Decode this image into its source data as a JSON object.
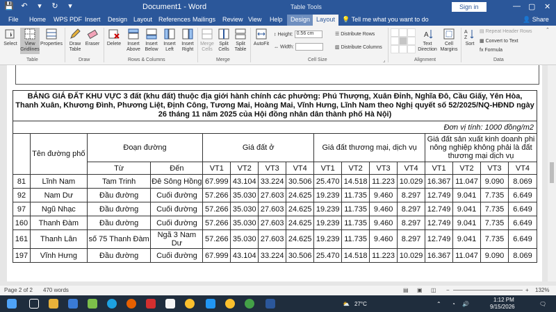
{
  "window": {
    "title": "Document1 - Word",
    "context_tools": "Table Tools",
    "sign_in": "Sign in",
    "minimize_glyph": "—",
    "restore_glyph": "▢",
    "close_glyph": "✕"
  },
  "quick_access": {
    "save": "💾",
    "undo": "↶",
    "undo_arrow": "▾",
    "redo": "↻",
    "customize": "▾"
  },
  "tabs": [
    "File",
    "Home",
    "WPS PDF",
    "Insert",
    "Design",
    "Layout",
    "References",
    "Mailings",
    "Review",
    "View",
    "Help",
    "Design",
    "Layout"
  ],
  "tell_me": "Tell me what you want to do",
  "share": "Share",
  "ribbon": {
    "select": "Select",
    "view_gridlines": "View Gridlines",
    "properties": "Properties",
    "draw_table": "Draw Table",
    "eraser": "Eraser",
    "delete": "Delete",
    "insert_above": "Insert Above",
    "insert_below": "Insert Below",
    "insert_left": "Insert Left",
    "insert_right": "Insert Right",
    "merge_cells": "Merge Cells",
    "split_cells": "Split Cells",
    "split_table": "Split Table",
    "autofit": "AutoFit",
    "height_label": "Height:",
    "height_value": "0.56 cm",
    "width_label": "Width:",
    "width_value": "",
    "distribute_rows": "Distribute Rows",
    "distribute_columns": "Distribute Columns",
    "text_direction": "Text Direction",
    "cell_margins": "Cell Margins",
    "sort": "Sort",
    "repeat_header_rows": "Repeat Header Rows",
    "convert_to_text": "Convert to Text",
    "formula": "Formula",
    "groups": {
      "table": "Table",
      "draw": "Draw",
      "rows_columns": "Rows & Columns",
      "merge": "Merge",
      "cell_size": "Cell Size",
      "alignment": "Alignment",
      "data": "Data"
    }
  },
  "document": {
    "heading": "BẢNG GIÁ ĐẤT KHU VỰC 3 đất (khu đất) thuộc địa giới hành chính các phường: Phú Thượng, Xuân Đỉnh, Nghĩa Đô, Cầu Giấy, Yên Hòa, Thanh Xuân, Khương Đình, Phương Liệt, Định Công, Tương Mai, Hoàng Mai, Vĩnh Hưng, Lĩnh Nam theo Nghị quyết số 52/2025/NQ-HĐND ngày 26 tháng 11 năm 2025 của Hội đồng nhân dân thành phố Hà Nội)",
    "unit": "Đơn vị tính: 1000 đồng/m2",
    "headers": {
      "street_name": "Tên đường phố",
      "segment": "Đoạn đường",
      "from": "Từ",
      "to": "Đến",
      "residential": "Giá đất ở",
      "commercial": "Giá đất thương mại, dịch vụ",
      "nonagri": "Giá đất sản xuất kinh doanh phi nông nghiệp không phải là đất thương mại dịch vụ",
      "vt": [
        "VT1",
        "VT2",
        "VT3",
        "VT4",
        "VT1",
        "VT2",
        "VT3",
        "VT4",
        "VT1",
        "VT2",
        "VT3",
        "VT4"
      ]
    },
    "rows": [
      {
        "stt": "81",
        "name": "Lĩnh Nam",
        "from": "Tam Trinh",
        "to": "Đê Sông Hồng",
        "vals": [
          "67.999",
          "43.104",
          "33.224",
          "30.506",
          "25.470",
          "14.518",
          "11.223",
          "10.029",
          "16.367",
          "11.047",
          "9.090",
          "8.069"
        ]
      },
      {
        "stt": "92",
        "name": "Nam Dư",
        "from": "Đầu đường",
        "to": "Cuối đường",
        "vals": [
          "57.266",
          "35.030",
          "27.603",
          "24.625",
          "19.239",
          "11.735",
          "9.460",
          "8.297",
          "12.749",
          "9.041",
          "7.735",
          "6.649"
        ]
      },
      {
        "stt": "97",
        "name": "Ngũ Nhạc",
        "from": "Đầu đường",
        "to": "Cuối đường",
        "vals": [
          "57.266",
          "35.030",
          "27.603",
          "24.625",
          "19.239",
          "11.735",
          "9.460",
          "8.297",
          "12.749",
          "9.041",
          "7.735",
          "6.649"
        ]
      },
      {
        "stt": "160",
        "name": "Thanh Đàm",
        "from": "Đầu đường",
        "to": "Cuối đường",
        "vals": [
          "57.266",
          "35.030",
          "27.603",
          "24.625",
          "19.239",
          "11.735",
          "9.460",
          "8.297",
          "12.749",
          "9.041",
          "7.735",
          "6.649"
        ]
      },
      {
        "stt": "161",
        "name": "Thanh Lân",
        "from": "số 75 Thanh Đàm",
        "to": "Ngã 3 Nam Dư",
        "vals": [
          "57.266",
          "35.030",
          "27.603",
          "24.625",
          "19.239",
          "11.735",
          "9.460",
          "8.297",
          "12.749",
          "9.041",
          "7.735",
          "6.649"
        ]
      },
      {
        "stt": "197",
        "name": "Vĩnh Hưng",
        "from": "Đầu đường",
        "to": "Cuối đường",
        "vals": [
          "67.999",
          "43.104",
          "33.224",
          "30.506",
          "25.470",
          "14.518",
          "11.223",
          "10.029",
          "16.367",
          "11.047",
          "9.090",
          "8.069"
        ]
      }
    ]
  },
  "status": {
    "page": "Page 2 of 2",
    "words": "470 words",
    "zoom": "132%"
  },
  "taskbar": {
    "weather": "27°C",
    "time": "1:12 PM",
    "date": "9/15/2026",
    "tray_up": "⌃"
  }
}
